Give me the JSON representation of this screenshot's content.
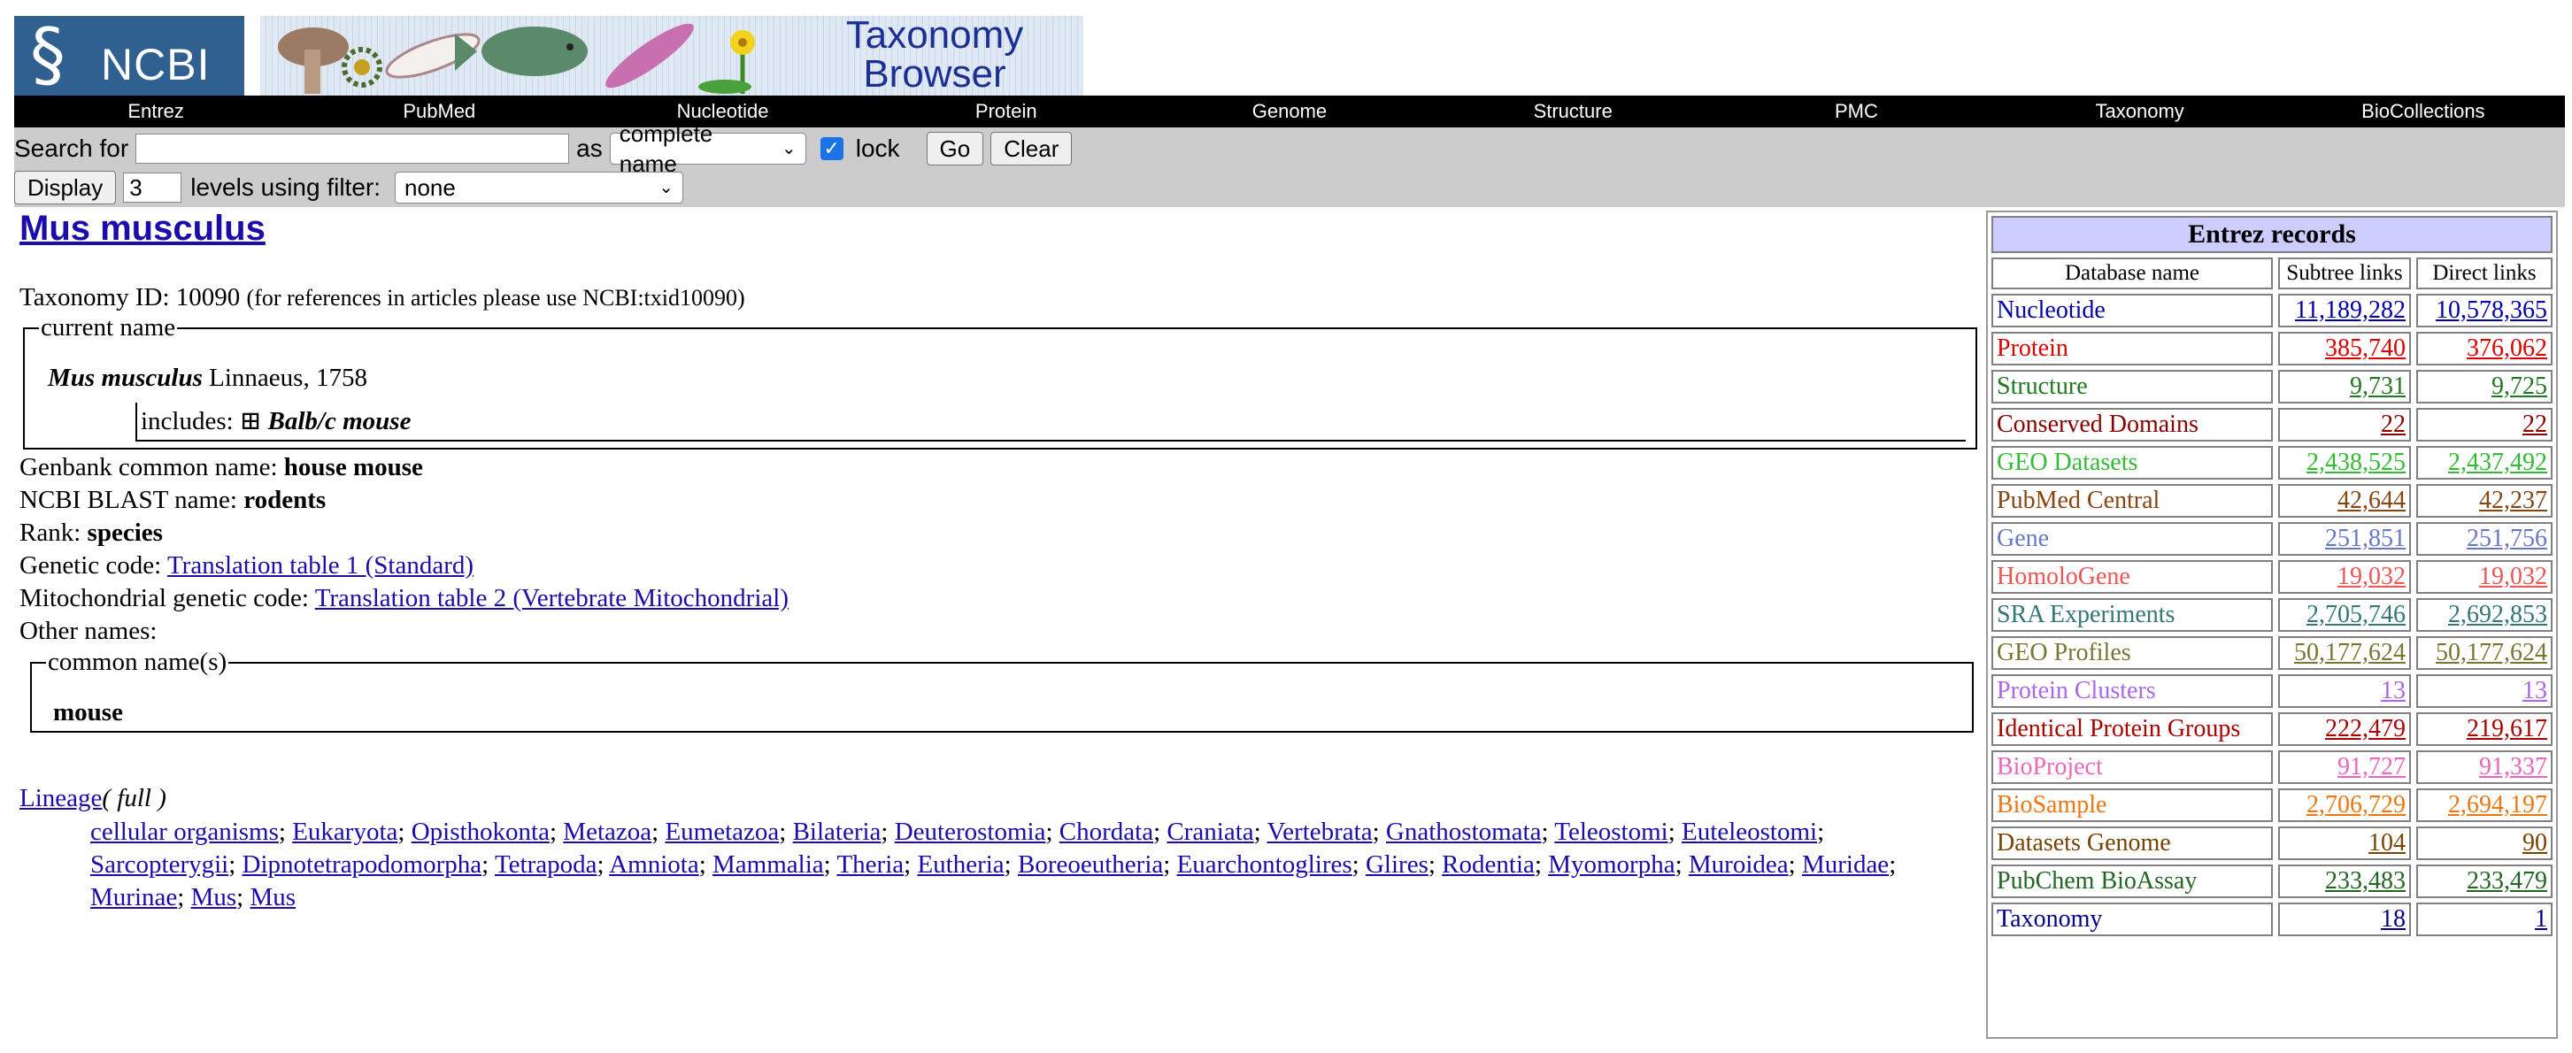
{
  "banner": {
    "logo_text": "NCBI",
    "title_line1": "Taxonomy",
    "title_line2": "Browser"
  },
  "nav": [
    "Entrez",
    "PubMed",
    "Nucleotide",
    "Protein",
    "Genome",
    "Structure",
    "PMC",
    "Taxonomy",
    "BioCollections"
  ],
  "search": {
    "label": "Search for",
    "value": "",
    "as_label": "as",
    "as_value": "complete name",
    "lock_label": "lock",
    "lock_checked": true,
    "go_label": "Go",
    "clear_label": "Clear",
    "display_label": "Display",
    "levels_value": "3",
    "levels_label": "levels using filter:",
    "filter_value": "none"
  },
  "organism": {
    "title": "Mus musculus",
    "taxid_label": "Taxonomy ID: 10090",
    "taxid_note": "(for references in articles please use NCBI:txid10090)",
    "current_name_legend": "current name",
    "sci_name": "Mus musculus",
    "authority": "Linnaeus, 1758",
    "includes_label": "includes:",
    "includes_icon": "⊞",
    "includes_name": "Balb/c mouse",
    "genbank_label": "Genbank common name:",
    "genbank_value": "house mouse",
    "blast_label": "NCBI BLAST name:",
    "blast_value": "rodents",
    "rank_label": "Rank:",
    "rank_value": "species",
    "genetic_code_label": "Genetic code:",
    "genetic_code_link": "Translation table 1 (Standard)",
    "mito_code_label": "Mitochondrial genetic code:",
    "mito_code_link": "Translation table 2 (Vertebrate Mitochondrial)",
    "other_names_label": "Other names:",
    "common_names_legend": "common name(s)",
    "common_name": "mouse",
    "lineage_label": "Lineage",
    "lineage_full": "( full )",
    "lineage": [
      "cellular organisms",
      "Eukaryota",
      "Opisthokonta",
      "Metazoa",
      "Eumetazoa",
      "Bilateria",
      "Deuterostomia",
      "Chordata",
      "Craniata",
      "Vertebrata",
      "Gnathostomata",
      "Teleostomi",
      "Euteleostomi",
      "Sarcopterygii",
      "Dipnotetrapodomorpha",
      "Tetrapoda",
      "Amniota",
      "Mammalia",
      "Theria",
      "Eutheria",
      "Boreoeutheria",
      "Euarchontoglires",
      "Glires",
      "Rodentia",
      "Myomorpha",
      "Muroidea",
      "Muridae",
      "Murinae",
      "Mus",
      "Mus"
    ]
  },
  "records": {
    "title": "Entrez records",
    "col_db": "Database name",
    "col_subtree": "Subtree links",
    "col_direct": "Direct links",
    "rows": [
      {
        "name": "Nucleotide",
        "subtree": "11,189,282",
        "direct": "10,578,365",
        "color": "#0000aa"
      },
      {
        "name": "Protein",
        "subtree": "385,740",
        "direct": "376,062",
        "color": "#dd0000"
      },
      {
        "name": "Structure",
        "subtree": "9,731",
        "direct": "9,725",
        "color": "#227722"
      },
      {
        "name": "Conserved Domains",
        "subtree": "22",
        "direct": "22",
        "color": "#880000"
      },
      {
        "name": "GEO Datasets",
        "subtree": "2,438,525",
        "direct": "2,437,492",
        "color": "#33bb33"
      },
      {
        "name": "PubMed Central",
        "subtree": "42,644",
        "direct": "42,237",
        "color": "#884411"
      },
      {
        "name": "Gene",
        "subtree": "251,851",
        "direct": "251,756",
        "color": "#6677cc"
      },
      {
        "name": "HomoloGene",
        "subtree": "19,032",
        "direct": "19,032",
        "color": "#ee5555"
      },
      {
        "name": "SRA Experiments",
        "subtree": "2,705,746",
        "direct": "2,692,853",
        "color": "#337777"
      },
      {
        "name": "GEO Profiles",
        "subtree": "50,177,624",
        "direct": "50,177,624",
        "color": "#777733"
      },
      {
        "name": "Protein Clusters",
        "subtree": "13",
        "direct": "13",
        "color": "#aa66ee"
      },
      {
        "name": "Identical Protein Groups",
        "subtree": "222,479",
        "direct": "219,617",
        "color": "#aa0000"
      },
      {
        "name": "BioProject",
        "subtree": "91,727",
        "direct": "91,337",
        "color": "#ee66bb"
      },
      {
        "name": "BioSample",
        "subtree": "2,706,729",
        "direct": "2,694,197",
        "color": "#ee7711"
      },
      {
        "name": "Datasets Genome",
        "subtree": "104",
        "direct": "90",
        "color": "#774400"
      },
      {
        "name": "PubChem BioAssay",
        "subtree": "233,483",
        "direct": "233,479",
        "color": "#226622"
      },
      {
        "name": "Taxonomy",
        "subtree": "18",
        "direct": "1",
        "color": "#000088"
      }
    ]
  }
}
